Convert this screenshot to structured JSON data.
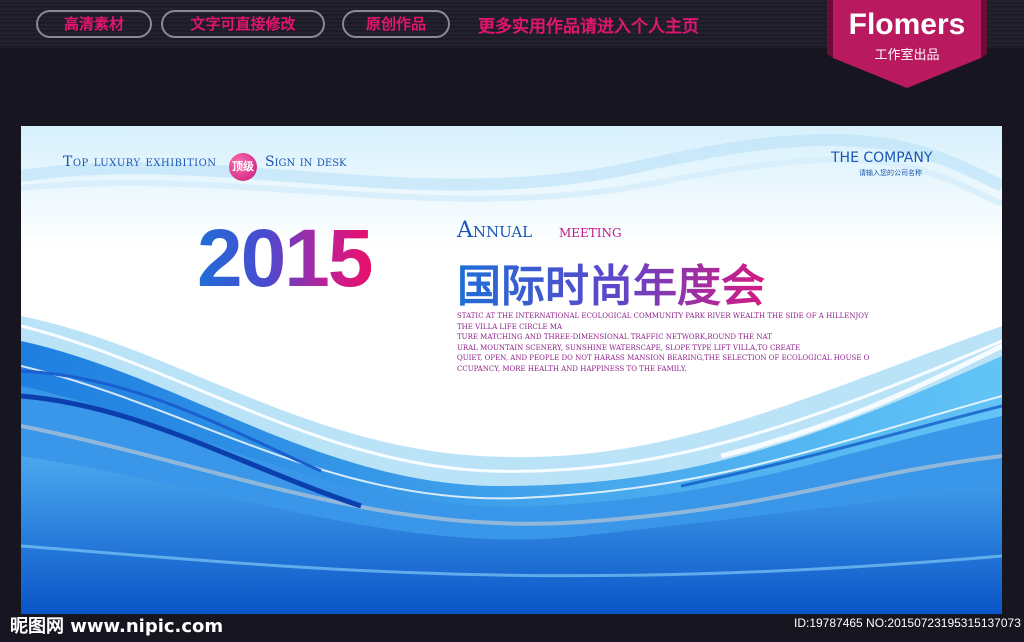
{
  "top_bar": {
    "tags": [
      "高清素材",
      "文字可直接修改",
      "原创作品"
    ],
    "promo": "更多实用作品请进入个人主页",
    "brand": {
      "name": "Flomers",
      "sub": "工作室出品",
      "color": "#b8195f"
    }
  },
  "poster": {
    "tagline_left": "Top luxury exhibition",
    "badge": "顶级",
    "tagline_right": "Sign in desk",
    "company": "THE COMPANY",
    "company_sub": "请输入您的公司名称",
    "year": "2015",
    "annual": "Annual",
    "meeting": "meeting",
    "title_cn": "国际时尚年度会",
    "body_lines": [
      "STATIC AT THE INTERNATIONAL ECOLOGICAL COMMUNITY PARK RIVER WEALTH THE SIDE OF A HILLENJOY",
      "THE VILLA LIFE CIRCLE MA",
      "TURE MATCHING AND THREE-DIMENSIONAL TRAFFIC NETWORK,ROUND THE NAT",
      "URAL MOUNTAIN SCENERY, SUNSHINE WATERSCAPE, SLOPE TYPE LIFT VILLA,TO CREATE",
      "QUIET, OPEN, AND PEOPLE DO NOT HARASS MANSION BEARING,THE SELECTION OF ECOLOGICAL HOUSE O",
      "CCUPANCY, MORE HEALTH AND HAPPINESS TO THE FAMILY."
    ],
    "accent_blue": "#1a56b4",
    "accent_magenta": "#c0188a"
  },
  "watermark": {
    "left": "昵图网 www.nipic.com",
    "right": "ID:19787465 NO:20150723195315137073"
  }
}
